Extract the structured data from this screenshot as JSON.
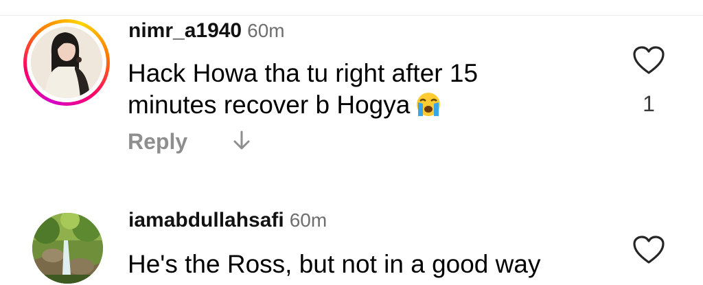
{
  "colors": {
    "username": "#111111",
    "timestamp": "#6e6e6e",
    "action": "#8e8e8e",
    "story_ring_start": "#d300c5",
    "story_ring_end": "#ffd600"
  },
  "comments": [
    {
      "username": "nimr_a1940",
      "time": "60m",
      "text": "Hack Howa tha tu right after 15 minutes recover b Hogya",
      "emoji_icon": "loudly-crying-face-icon",
      "has_story_ring": true,
      "reply_label": "Reply",
      "reply_icon": "arrow-down-icon",
      "like_icon": "heart-outline-icon",
      "like_count": "1"
    },
    {
      "username": "iamabdullahsafi",
      "time": "60m",
      "text": "He's the Ross, but not in a good way",
      "has_story_ring": false,
      "like_icon": "heart-outline-icon"
    }
  ]
}
